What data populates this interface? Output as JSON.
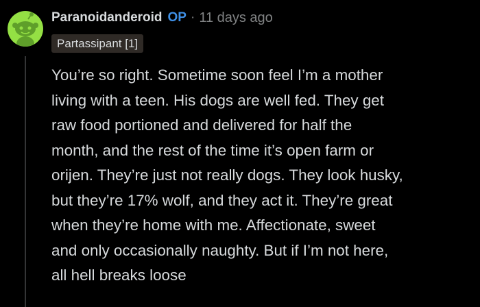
{
  "comment": {
    "username": "Paranoidanderoid",
    "op_badge": "OP",
    "separator": "·",
    "timestamp": "11 days ago",
    "flair": "Partassipant [1]",
    "body_lines": [
      "You’re so right. Sometime soon feel I’m a mother",
      "living with a teen. His dogs are well fed. They get",
      "raw food portioned and delivered for half the",
      "month, and the rest of the time it’s open farm or",
      "orijen. They’re just not really dogs. They look husky,",
      "but they’re 17% wolf, and they act it. They’re great",
      "when they’re home with me. Affectionate, sweet",
      "and only occasionally naughty. But if I’m not here,",
      "all hell breaks loose"
    ],
    "avatar_icon": "snoo-avatar-icon"
  },
  "colors": {
    "background": "#000000",
    "avatar_bg": "#94e044",
    "op_badge": "#3f90e6",
    "text": "#d7dadc",
    "meta": "#818384",
    "flair_bg": "#2f2a26"
  }
}
